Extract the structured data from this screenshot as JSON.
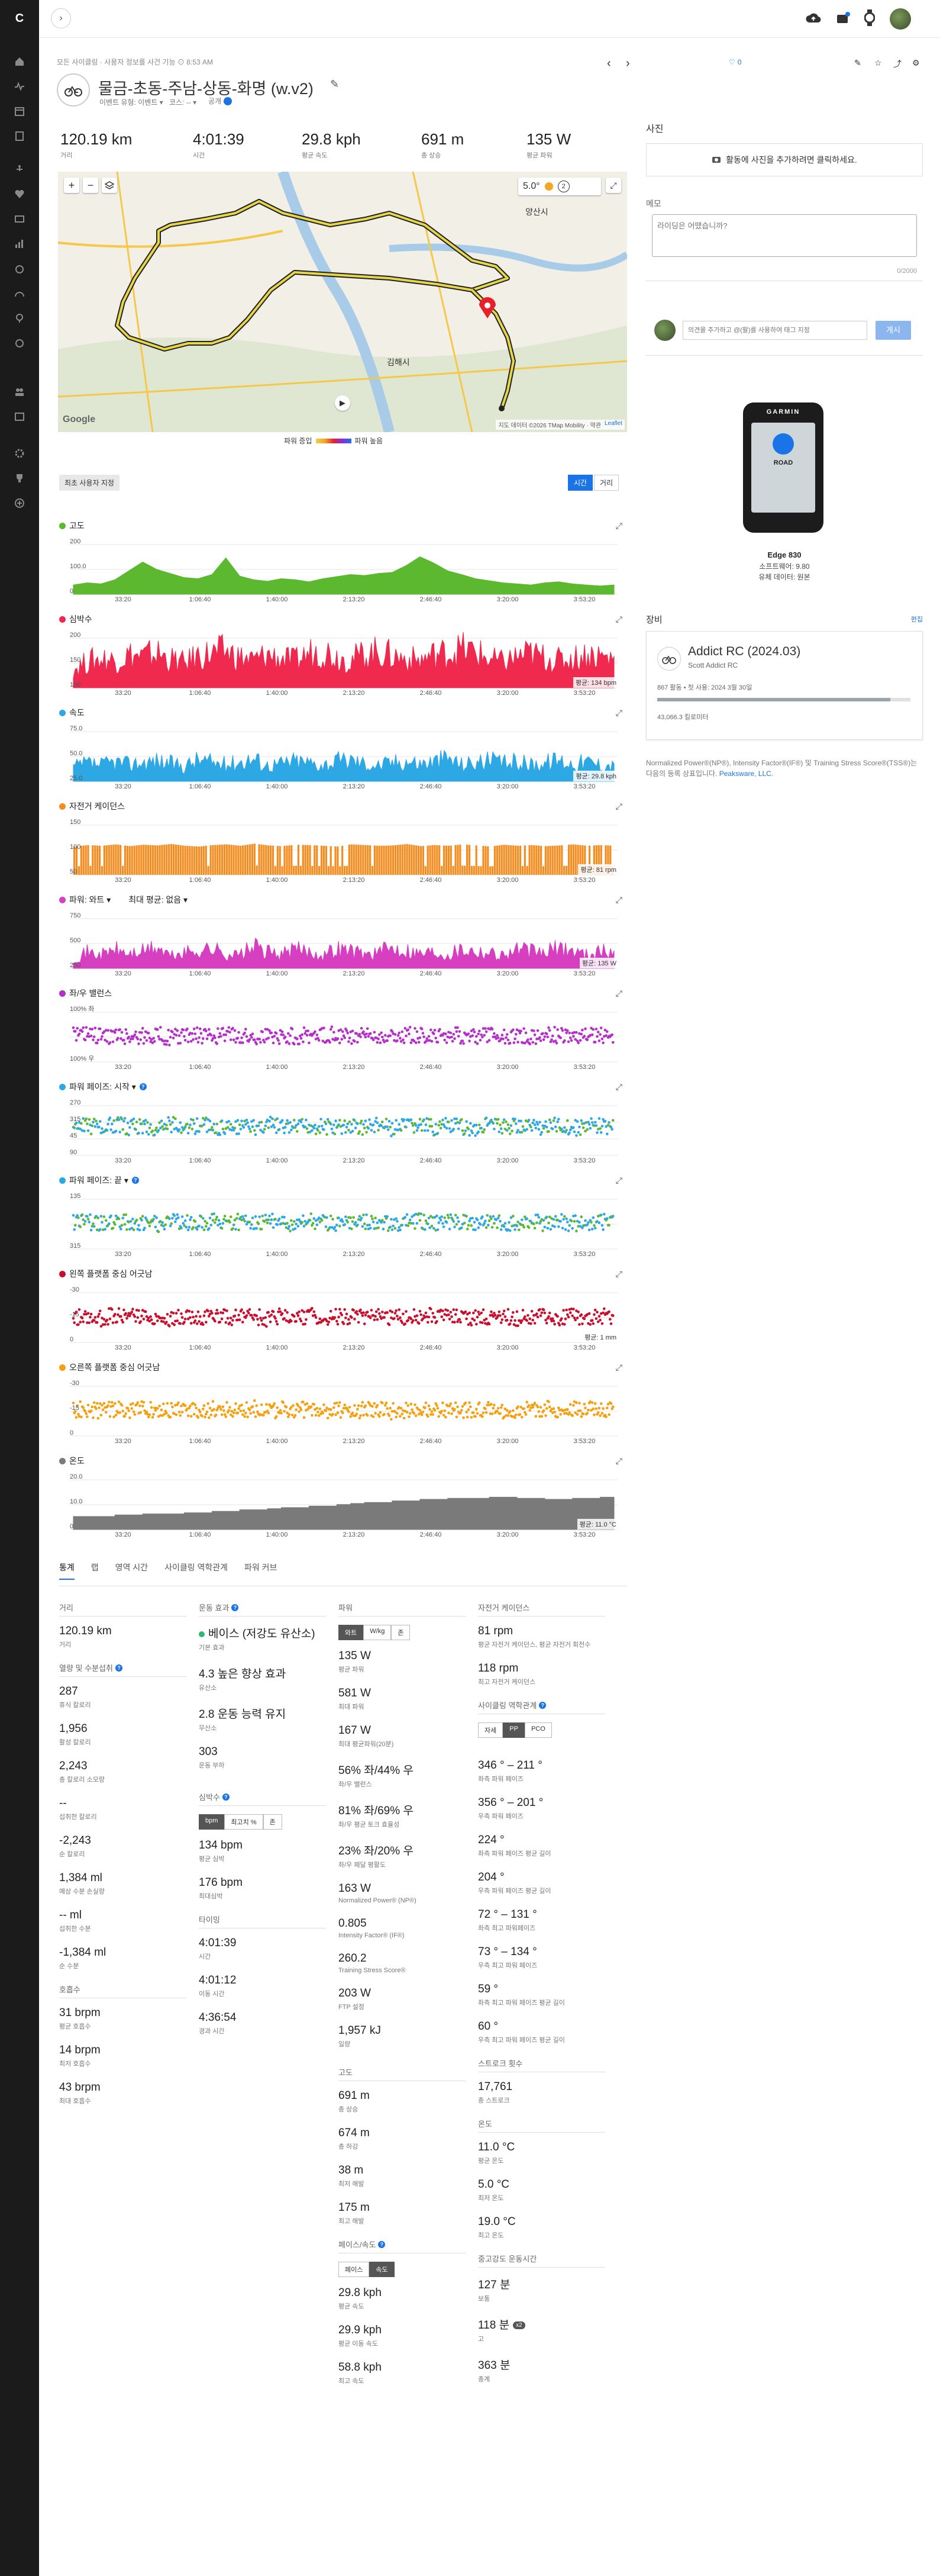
{
  "header": {
    "breadcrumb": "모든 사이클링 · 사용자 정보를 사건 기능 ⊙ 8:53 AM",
    "activity_title": "물금-초동-주남-상동-화명 (w.v2)",
    "activity_type": "이벤트 유형: 이벤트 ▾",
    "course": "코스: -- ▾",
    "privacy": "공개",
    "likes": "0"
  },
  "summary": [
    {
      "value": "120.19 km",
      "label": "거리"
    },
    {
      "value": "4:01:39",
      "label": "시간"
    },
    {
      "value": "29.8 kph",
      "label": "평균 속도"
    },
    {
      "value": "691 m",
      "label": "총 상승"
    },
    {
      "value": "135 W",
      "label": "평균 파워"
    }
  ],
  "map": {
    "temperature": "5.0°",
    "weather_badge": "2",
    "place_yangsan": "양산시",
    "place_gimhae": "김해시",
    "legend_left": "파워 증입",
    "legend_right": "파워 높음",
    "attribution": "지도 데이터 ©2026 TMap Mobility · 약관",
    "leaflet": "Leaflet",
    "google": "Google"
  },
  "chart_controls": {
    "best_user_button": "최초 사용자 지정",
    "time_button": "시간",
    "distance_button": "거리"
  },
  "x_ticks": [
    "33:20",
    "1:06:40",
    "1:40:00",
    "2:13:20",
    "2:46:40",
    "3:20:00",
    "3:53:20"
  ],
  "charts": [
    {
      "key": "elevation",
      "title": "고도",
      "color": "#5cb82f",
      "type": "area",
      "yticks": [
        "200",
        "100.0",
        "0"
      ],
      "badge": "",
      "values": [
        18,
        22,
        20,
        28,
        45,
        62,
        48,
        40,
        32,
        30,
        38,
        70,
        35,
        28,
        25,
        30,
        28,
        24,
        30,
        34,
        38,
        36,
        40,
        42,
        55,
        72,
        60,
        45,
        38,
        30,
        26,
        22,
        20,
        18,
        22,
        24,
        20,
        18,
        16,
        18
      ]
    },
    {
      "key": "heart_rate",
      "title": "심박수",
      "color": "#f0294f",
      "type": "spiky",
      "yticks": [
        "200",
        "150",
        "100"
      ],
      "badge": "평균: 134 bpm",
      "values": [
        40,
        55,
        62,
        58,
        70,
        66,
        74,
        60,
        52,
        68,
        72,
        78,
        64,
        58,
        70,
        62,
        56,
        74,
        80,
        66,
        60,
        72,
        76,
        68,
        62,
        58,
        70,
        74,
        82,
        76,
        60,
        54,
        66,
        72,
        64,
        58,
        62,
        70,
        68,
        60
      ]
    },
    {
      "key": "speed",
      "title": "속도",
      "color": "#2ea8e5",
      "type": "spiky",
      "yticks": [
        "75.0",
        "50.0",
        "25.0"
      ],
      "badge": "평균: 29.8 kph",
      "values": [
        30,
        38,
        34,
        42,
        36,
        40,
        44,
        38,
        32,
        46,
        40,
        36,
        42,
        48,
        34,
        38,
        44,
        40,
        36,
        42,
        46,
        38,
        34,
        40,
        44,
        38,
        42,
        50,
        36,
        40,
        44,
        38,
        42,
        36,
        40,
        46,
        38,
        42,
        36,
        34
      ]
    },
    {
      "key": "cadence",
      "title": "자전거 케이던스",
      "color": "#f58c1f",
      "type": "bars",
      "yticks": [
        "150",
        "100",
        "50"
      ],
      "badge": "평균: 81 rpm",
      "values": [
        78,
        82,
        80,
        84,
        79,
        83,
        81,
        85,
        80,
        78,
        82,
        84,
        80,
        86,
        81,
        79,
        83,
        82,
        80,
        78,
        84,
        82,
        80,
        81,
        85,
        79,
        82,
        80,
        84,
        81,
        78,
        83,
        80,
        82,
        79,
        81,
        84,
        80,
        82,
        80
      ]
    },
    {
      "key": "power",
      "title": "파워: 와트 ▾",
      "subtitle": "최대 평균: 없음 ▾",
      "color": "#d63fbf",
      "type": "spiky",
      "yticks": [
        "750",
        "500",
        "250"
      ],
      "badge": "평균: 135 W",
      "values": [
        20,
        34,
        28,
        40,
        30,
        36,
        44,
        26,
        32,
        38,
        42,
        30,
        28,
        46,
        34,
        30,
        40,
        36,
        28,
        42,
        38,
        30,
        34,
        44,
        40,
        32,
        36,
        30,
        42,
        38,
        34,
        28,
        40,
        36,
        32,
        44,
        38,
        30,
        36,
        34
      ]
    },
    {
      "key": "lr_balance",
      "title": "좌/우 밸런스",
      "color": "#b530c8",
      "type": "dots",
      "yticks": [
        "100% 좌",
        "",
        "100% 우"
      ],
      "badge": "",
      "values": [
        50,
        52,
        48,
        51,
        49,
        50,
        53,
        47,
        50,
        52,
        49,
        51,
        50,
        48,
        52,
        50,
        49,
        51,
        50,
        53,
        48,
        50,
        51,
        49,
        52,
        50,
        48,
        51,
        50,
        49,
        52,
        50,
        51,
        48,
        50,
        52,
        49,
        51,
        50,
        50
      ]
    },
    {
      "key": "power_phase_start",
      "title": "파워 페이즈: 시작 ▾",
      "color": "#2ea8e5",
      "color2": "#5cb82f",
      "type": "dots2",
      "yticks": [
        "270",
        "315",
        "45",
        "90"
      ],
      "badge": "",
      "values": [
        55,
        58,
        52,
        60,
        54,
        57,
        53,
        59,
        56,
        55,
        58,
        52,
        57,
        54,
        60,
        55,
        53,
        58,
        56,
        54,
        57,
        55,
        59,
        52,
        56,
        58,
        54,
        57,
        55,
        53,
        58,
        56,
        54,
        57,
        55,
        59,
        53,
        56,
        58,
        55
      ]
    },
    {
      "key": "power_phase_end",
      "title": "파워 페이즈: 끝 ▾",
      "color": "#2ea8e5",
      "color2": "#5cb82f",
      "type": "dots2",
      "yticks": [
        "135",
        "",
        "315"
      ],
      "badge": "",
      "values": [
        50,
        53,
        48,
        55,
        49,
        52,
        47,
        54,
        51,
        50,
        53,
        48,
        52,
        49,
        55,
        50,
        48,
        53,
        51,
        49,
        52,
        50,
        54,
        47,
        51,
        53,
        49,
        52,
        50,
        48,
        53,
        51,
        49,
        52,
        50,
        54,
        48,
        51,
        53,
        50
      ]
    },
    {
      "key": "left_pco",
      "title": "왼쪽 플랫폼 중심 어긋남",
      "color": "#c8102e",
      "type": "dots",
      "yticks": [
        "-30",
        "-15",
        "0"
      ],
      "badge": "평균: 1 mm",
      "values": [
        48,
        50,
        46,
        52,
        49,
        47,
        51,
        45,
        50,
        48,
        52,
        47,
        49,
        51,
        46,
        50,
        48,
        52,
        47,
        49,
        50,
        46,
        51,
        48,
        50,
        47,
        52,
        49,
        46,
        50,
        48,
        51,
        47,
        49,
        52,
        48,
        50,
        46,
        49,
        50
      ]
    },
    {
      "key": "right_pco",
      "title": "오른쪽 플랫폼 중심 어긋남",
      "color": "#f5a00f",
      "type": "dots",
      "yticks": [
        "-30",
        "-15",
        "0"
      ],
      "badge": "",
      "values": [
        50,
        52,
        48,
        51,
        49,
        53,
        47,
        50,
        52,
        48,
        51,
        49,
        50,
        53,
        47,
        51,
        49,
        52,
        48,
        50,
        51,
        49,
        53,
        47,
        50,
        52,
        48,
        51,
        49,
        50,
        52,
        48,
        51,
        49,
        53,
        47,
        50,
        52,
        48,
        50
      ]
    },
    {
      "key": "temperature",
      "title": "온도",
      "color": "#7a7a7a",
      "type": "steps",
      "yticks": [
        "20.0",
        "10.0",
        "0"
      ],
      "badge": "평균: 11.0 °C",
      "values": [
        25,
        25,
        25,
        28,
        28,
        30,
        30,
        30,
        32,
        32,
        35,
        35,
        38,
        38,
        40,
        42,
        42,
        45,
        45,
        48,
        50,
        52,
        52,
        55,
        55,
        58,
        58,
        60,
        60,
        60,
        62,
        62,
        60,
        60,
        58,
        58,
        60,
        60,
        62,
        62
      ]
    }
  ],
  "photo": {
    "title": "사진",
    "button": "활동에 사진을 추가하려면 클릭하세요."
  },
  "notes": {
    "title": "메모",
    "placeholder": "라이딩은 어땠습니까?",
    "counter": "0/2000"
  },
  "comment": {
    "placeholder": "의견을 추가하고 @(팔)를 사용하여 태그 지정",
    "button": "게시"
  },
  "device": {
    "screen_label": "ROAD",
    "brand": "GARMIN",
    "name": "Edge 830",
    "software": "소프트웨어: 9.80",
    "source": "유체 데이터: 원본"
  },
  "gear": {
    "title": "장비",
    "edit": "편집",
    "name": "Addict RC (2024.03)",
    "model": "Scott Addict RC",
    "usage": "867 활동 • 첫 사용: 2024 3월 30일",
    "distance": "43,066.3 킬로미터",
    "progress": 0.92
  },
  "footnote": {
    "text": "Normalized Power®(NP®), Intensity Factor®(IF®) 및 Training Stress Score®(TSS®)는 다음의 등록 상표입니다.",
    "link": "Peaksware, LLC."
  },
  "stats_tabs": [
    "통계",
    "랩",
    "영역 시간",
    "사이클링 역학관계",
    "파워 커브"
  ],
  "stats": {
    "col1": {
      "distance_head": "거리",
      "distance": {
        "value": "120.19 km",
        "label": "거리"
      },
      "nutrition_head": "열량 및 수분섭취",
      "nutrition": [
        {
          "value": "287",
          "label": "휴식 칼로리"
        },
        {
          "value": "1,956",
          "label": "활성 칼로리"
        },
        {
          "value": "2,243",
          "label": "총 칼로리 소모량"
        },
        {
          "value": "--",
          "label": "섭취한 칼로리"
        },
        {
          "value": "-2,243",
          "label": "순 칼로리"
        },
        {
          "value": "1,384 ml",
          "label": "예상 수분 손실량"
        },
        {
          "value": "-- ml",
          "label": "섭취한 수분"
        },
        {
          "value": "-1,384 ml",
          "label": "순 수분"
        }
      ],
      "resp_head": "호흡수",
      "resp": [
        {
          "value": "31 brpm",
          "label": "평균 호흡수"
        },
        {
          "value": "14 brpm",
          "label": "최저 호흡수"
        },
        {
          "value": "43 brpm",
          "label": "최대 호흡수"
        }
      ]
    },
    "col2": {
      "effect_head": "운동 효과",
      "effect": [
        {
          "value": "베이스 (저강도 유산소)",
          "label": "기본 효과"
        },
        {
          "value": "4.3 높은 향상 효과",
          "label": "유산소"
        },
        {
          "value": "2.8 운동 능력 유지",
          "label": "무산소"
        },
        {
          "value": "303",
          "label": "운동 부하"
        }
      ],
      "hr_head": "심박수",
      "hr_toggle": [
        "bpm",
        "최고치 %",
        "존"
      ],
      "hr": [
        {
          "value": "134 bpm",
          "label": "평균 심박"
        },
        {
          "value": "176 bpm",
          "label": "최대심박"
        }
      ],
      "timing_head": "타이밍",
      "timing": [
        {
          "value": "4:01:39",
          "label": "시간"
        },
        {
          "value": "4:01:12",
          "label": "이동 시간"
        },
        {
          "value": "4:36:54",
          "label": "경과 시간"
        }
      ]
    },
    "col3": {
      "power_head": "파워",
      "power_toggle": [
        "와트",
        "W/kg",
        "존"
      ],
      "power": [
        {
          "value": "135 W",
          "label": "평균 파워"
        },
        {
          "value": "581 W",
          "label": "최대 파워"
        },
        {
          "value": "167 W",
          "label": "최대 평균파워(20분)"
        },
        {
          "value": "56% 좌/44% 우",
          "label": "좌/우 밸런스"
        },
        {
          "value": "81% 좌/69% 우",
          "label": "좌/우 평균 토크 효율성"
        },
        {
          "value": "23% 좌/20% 우",
          "label": "좌/우 페달 평활도"
        },
        {
          "value": "163 W",
          "label": "Normalized Power® (NP®)"
        },
        {
          "value": "0.805",
          "label": "Intensity Factor® (IF®)"
        },
        {
          "value": "260.2",
          "label": "Training Stress Score®"
        },
        {
          "value": "203 W",
          "label": "FTP 설정"
        },
        {
          "value": "1,957 kJ",
          "label": "일량"
        }
      ],
      "elev_head": "고도",
      "elev": [
        {
          "value": "691 m",
          "label": "총 상승"
        },
        {
          "value": "674 m",
          "label": "총 하강"
        },
        {
          "value": "38 m",
          "label": "최저 해발"
        },
        {
          "value": "175 m",
          "label": "최고 해발"
        }
      ],
      "pace_head": "페이스/속도",
      "pace_toggle": [
        "페이스",
        "속도"
      ],
      "pace": [
        {
          "value": "29.8 kph",
          "label": "평균 속도"
        },
        {
          "value": "29.9 kph",
          "label": "평균 이동 속도"
        },
        {
          "value": "58.8 kph",
          "label": "최고 속도"
        }
      ]
    },
    "col4": {
      "cad_head": "자전거 케이던스",
      "cad": [
        {
          "value": "81 rpm",
          "label": "평균 자전거 케이던스, 평균 자전거 회전수"
        },
        {
          "value": "118 rpm",
          "label": "최고 자전거 케이던스"
        }
      ],
      "dyn_head": "사이클링 역학관계",
      "dyn_toggle": [
        "자세",
        "PP",
        "PCO"
      ],
      "dyn": [
        {
          "value": "346 ° – 211 °",
          "label": "좌측 파워 페이즈"
        },
        {
          "value": "356 ° – 201 °",
          "label": "우측 파워 페이즈"
        },
        {
          "value": "224 °",
          "label": "좌측 파워 페이즈 평균 길이"
        },
        {
          "value": "204 °",
          "label": "우측 파워 페이즈 평균 길이"
        },
        {
          "value": "72 ° – 131 °",
          "label": "좌측 최고 파워페이즈"
        },
        {
          "value": "73 ° – 134 °",
          "label": "우측 최고 파워 페이즈"
        },
        {
          "value": "59 °",
          "label": "좌측 최고 파워 페이즈 평균 길이"
        },
        {
          "value": "60 °",
          "label": "우측 최고 파워 페이즈 평균 길이"
        }
      ],
      "stroke_head": "스트로크 횟수",
      "stroke": [
        {
          "value": "17,761",
          "label": "총 스트로크"
        }
      ],
      "temp_head": "온도",
      "temp": [
        {
          "value": "11.0 °C",
          "label": "평균 온도"
        },
        {
          "value": "5.0 °C",
          "label": "최저 온도"
        },
        {
          "value": "19.0 °C",
          "label": "최고 온도"
        }
      ],
      "intensity_head": "중고강도 운동시간",
      "intensity": [
        {
          "value": "127 분",
          "label": "보통"
        },
        {
          "value": "118 분",
          "label": "고",
          "badge": "x2"
        },
        {
          "value": "363 분",
          "label": "총계"
        }
      ]
    }
  }
}
